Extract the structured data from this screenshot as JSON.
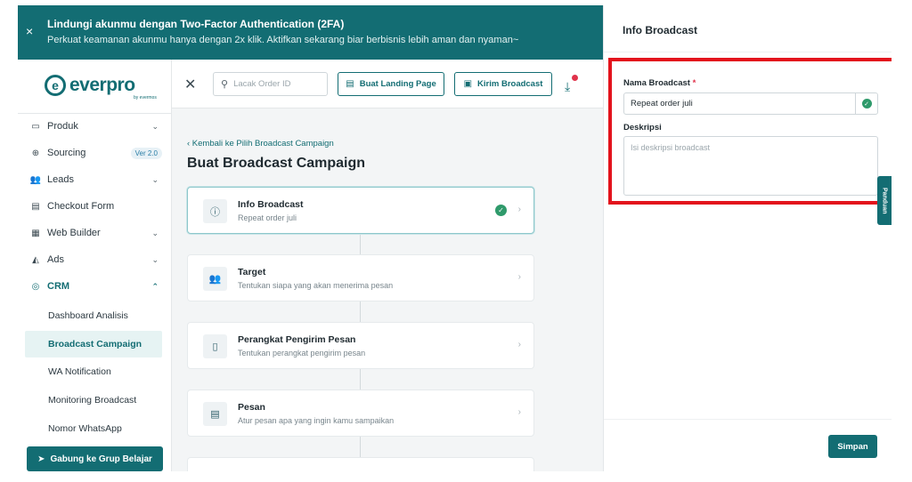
{
  "banner": {
    "title": "Lindungi akunmu dengan Two-Factor Authentication (2FA)",
    "subtitle": "Perkuat keamanan akunmu hanya dengan 2x klik. Aktifkan sekarang biar berbisnis lebih aman dan nyaman~",
    "close_icon": "×"
  },
  "logo": {
    "mark": "e",
    "word": "everpro",
    "by": "by evermos"
  },
  "sidebar": {
    "items": [
      {
        "label": "Produk",
        "icon": "▭",
        "chevron": "⌄"
      },
      {
        "label": "Sourcing",
        "icon": "⊕",
        "badge": "Ver 2.0"
      },
      {
        "label": "Leads",
        "icon": "👥",
        "chevron": "⌄"
      },
      {
        "label": "Checkout Form",
        "icon": "▤"
      },
      {
        "label": "Web Builder",
        "icon": "▦",
        "chevron": "⌄"
      },
      {
        "label": "Ads",
        "icon": "◭",
        "chevron": "⌄"
      },
      {
        "label": "CRM",
        "icon": "◎",
        "chevron": "⌃"
      }
    ],
    "sub_items": [
      "Dashboard Analisis",
      "Broadcast Campaign",
      "WA Notification",
      "Monitoring Broadcast",
      "Nomor WhatsApp"
    ],
    "join_button": "Gabung ke Grup Belajar",
    "join_icon": "➤"
  },
  "topbar": {
    "close_icon": "✕",
    "search_placeholder": "Lacak Order ID",
    "search_icon": "⚲",
    "landing_button": "Buat Landing Page",
    "landing_icon": "▤",
    "broadcast_button": "Kirim Broadcast",
    "broadcast_icon": "▣",
    "download_icon": "⤓"
  },
  "content": {
    "back_link": "‹ Kembali ke Pilih Broadcast Campaign",
    "title": "Buat Broadcast Campaign",
    "steps": [
      {
        "title": "Info Broadcast",
        "subtitle": "Repeat order juli",
        "icon": "ⓘ",
        "done": "✓"
      },
      {
        "title": "Target",
        "subtitle": "Tentukan siapa yang akan menerima pesan",
        "icon": "👥"
      },
      {
        "title": "Perangkat Pengirim Pesan",
        "subtitle": "Tentukan perangkat pengirim pesan",
        "icon": "▯"
      },
      {
        "title": "Pesan",
        "subtitle": "Atur pesan apa yang ingin kamu sampaikan",
        "icon": "▤"
      }
    ],
    "arrow": "›"
  },
  "panel": {
    "title": "Info Broadcast",
    "name_label": "Nama Broadcast",
    "required_mark": "*",
    "name_value": "Repeat order juli",
    "name_ok": "✓",
    "desc_label": "Deskripsi",
    "desc_placeholder": "Isi deskripsi broadcast",
    "guide_tab": "Panduan",
    "save_button": "Simpan",
    "highlight_color": "#e3131c"
  },
  "colors": {
    "brand": "#136d73",
    "success": "#2f9a6b",
    "alert": "#e0334b"
  }
}
